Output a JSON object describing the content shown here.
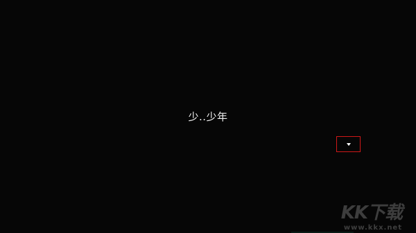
{
  "dialogue": {
    "text": "少..少年"
  },
  "advance_button": {
    "icon": "caret-down-icon",
    "border_color": "#d01818"
  },
  "watermark": {
    "logo_text": "KK下载",
    "url_text": "www.kkx.net"
  },
  "colors": {
    "background": "#060606",
    "text": "#f2f2f2"
  }
}
